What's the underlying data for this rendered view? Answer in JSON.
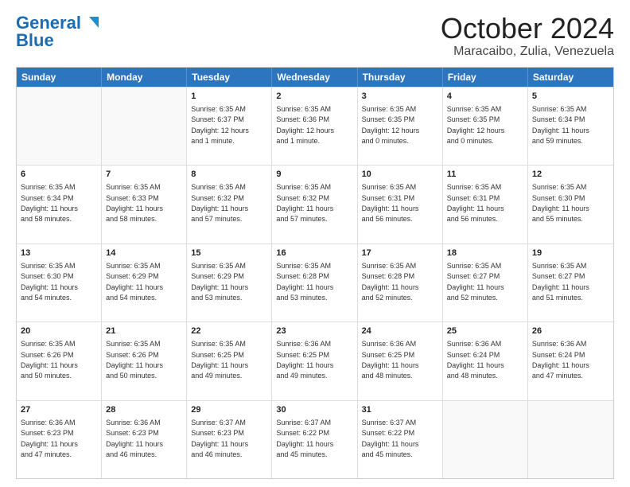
{
  "logo": {
    "line1": "General",
    "line2": "Blue"
  },
  "header": {
    "month": "October 2024",
    "location": "Maracaibo, Zulia, Venezuela"
  },
  "weekdays": [
    "Sunday",
    "Monday",
    "Tuesday",
    "Wednesday",
    "Thursday",
    "Friday",
    "Saturday"
  ],
  "weeks": [
    [
      {
        "day": "",
        "text": ""
      },
      {
        "day": "",
        "text": ""
      },
      {
        "day": "1",
        "text": "Sunrise: 6:35 AM\nSunset: 6:37 PM\nDaylight: 12 hours\nand 1 minute."
      },
      {
        "day": "2",
        "text": "Sunrise: 6:35 AM\nSunset: 6:36 PM\nDaylight: 12 hours\nand 1 minute."
      },
      {
        "day": "3",
        "text": "Sunrise: 6:35 AM\nSunset: 6:35 PM\nDaylight: 12 hours\nand 0 minutes."
      },
      {
        "day": "4",
        "text": "Sunrise: 6:35 AM\nSunset: 6:35 PM\nDaylight: 12 hours\nand 0 minutes."
      },
      {
        "day": "5",
        "text": "Sunrise: 6:35 AM\nSunset: 6:34 PM\nDaylight: 11 hours\nand 59 minutes."
      }
    ],
    [
      {
        "day": "6",
        "text": "Sunrise: 6:35 AM\nSunset: 6:34 PM\nDaylight: 11 hours\nand 58 minutes."
      },
      {
        "day": "7",
        "text": "Sunrise: 6:35 AM\nSunset: 6:33 PM\nDaylight: 11 hours\nand 58 minutes."
      },
      {
        "day": "8",
        "text": "Sunrise: 6:35 AM\nSunset: 6:32 PM\nDaylight: 11 hours\nand 57 minutes."
      },
      {
        "day": "9",
        "text": "Sunrise: 6:35 AM\nSunset: 6:32 PM\nDaylight: 11 hours\nand 57 minutes."
      },
      {
        "day": "10",
        "text": "Sunrise: 6:35 AM\nSunset: 6:31 PM\nDaylight: 11 hours\nand 56 minutes."
      },
      {
        "day": "11",
        "text": "Sunrise: 6:35 AM\nSunset: 6:31 PM\nDaylight: 11 hours\nand 56 minutes."
      },
      {
        "day": "12",
        "text": "Sunrise: 6:35 AM\nSunset: 6:30 PM\nDaylight: 11 hours\nand 55 minutes."
      }
    ],
    [
      {
        "day": "13",
        "text": "Sunrise: 6:35 AM\nSunset: 6:30 PM\nDaylight: 11 hours\nand 54 minutes."
      },
      {
        "day": "14",
        "text": "Sunrise: 6:35 AM\nSunset: 6:29 PM\nDaylight: 11 hours\nand 54 minutes."
      },
      {
        "day": "15",
        "text": "Sunrise: 6:35 AM\nSunset: 6:29 PM\nDaylight: 11 hours\nand 53 minutes."
      },
      {
        "day": "16",
        "text": "Sunrise: 6:35 AM\nSunset: 6:28 PM\nDaylight: 11 hours\nand 53 minutes."
      },
      {
        "day": "17",
        "text": "Sunrise: 6:35 AM\nSunset: 6:28 PM\nDaylight: 11 hours\nand 52 minutes."
      },
      {
        "day": "18",
        "text": "Sunrise: 6:35 AM\nSunset: 6:27 PM\nDaylight: 11 hours\nand 52 minutes."
      },
      {
        "day": "19",
        "text": "Sunrise: 6:35 AM\nSunset: 6:27 PM\nDaylight: 11 hours\nand 51 minutes."
      }
    ],
    [
      {
        "day": "20",
        "text": "Sunrise: 6:35 AM\nSunset: 6:26 PM\nDaylight: 11 hours\nand 50 minutes."
      },
      {
        "day": "21",
        "text": "Sunrise: 6:35 AM\nSunset: 6:26 PM\nDaylight: 11 hours\nand 50 minutes."
      },
      {
        "day": "22",
        "text": "Sunrise: 6:35 AM\nSunset: 6:25 PM\nDaylight: 11 hours\nand 49 minutes."
      },
      {
        "day": "23",
        "text": "Sunrise: 6:36 AM\nSunset: 6:25 PM\nDaylight: 11 hours\nand 49 minutes."
      },
      {
        "day": "24",
        "text": "Sunrise: 6:36 AM\nSunset: 6:25 PM\nDaylight: 11 hours\nand 48 minutes."
      },
      {
        "day": "25",
        "text": "Sunrise: 6:36 AM\nSunset: 6:24 PM\nDaylight: 11 hours\nand 48 minutes."
      },
      {
        "day": "26",
        "text": "Sunrise: 6:36 AM\nSunset: 6:24 PM\nDaylight: 11 hours\nand 47 minutes."
      }
    ],
    [
      {
        "day": "27",
        "text": "Sunrise: 6:36 AM\nSunset: 6:23 PM\nDaylight: 11 hours\nand 47 minutes."
      },
      {
        "day": "28",
        "text": "Sunrise: 6:36 AM\nSunset: 6:23 PM\nDaylight: 11 hours\nand 46 minutes."
      },
      {
        "day": "29",
        "text": "Sunrise: 6:37 AM\nSunset: 6:23 PM\nDaylight: 11 hours\nand 46 minutes."
      },
      {
        "day": "30",
        "text": "Sunrise: 6:37 AM\nSunset: 6:22 PM\nDaylight: 11 hours\nand 45 minutes."
      },
      {
        "day": "31",
        "text": "Sunrise: 6:37 AM\nSunset: 6:22 PM\nDaylight: 11 hours\nand 45 minutes."
      },
      {
        "day": "",
        "text": ""
      },
      {
        "day": "",
        "text": ""
      }
    ]
  ]
}
